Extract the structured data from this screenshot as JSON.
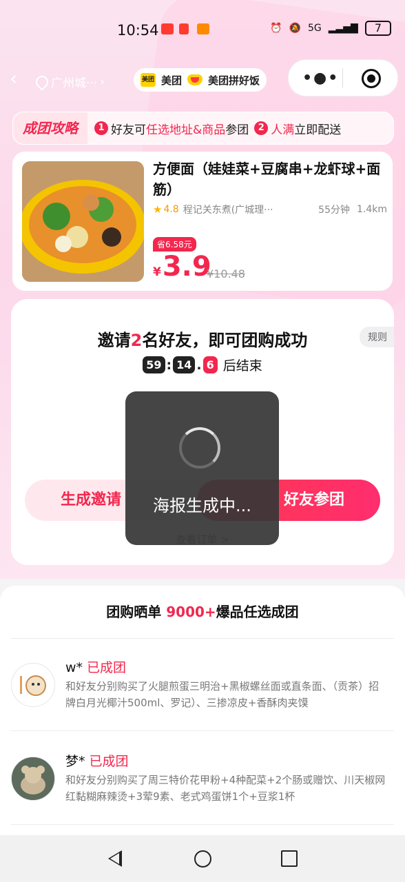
{
  "status_bar": {
    "time": "10:54",
    "network": "5G",
    "battery": "7"
  },
  "nav": {
    "location": "广州城···",
    "brand_meituan": "美团",
    "brand_pinhaofan": "美团拼好饭"
  },
  "strategy": {
    "tag": "成团攻略",
    "step1_num": "1",
    "step1_prefix": "好友可",
    "step1_highlight": "任选地址&商品",
    "step1_suffix": "参团",
    "step2_num": "2",
    "step2_highlight": "人满",
    "step2_suffix": "立即配送"
  },
  "product": {
    "name": "方便面（娃娃菜+豆腐串+龙虾球+面筋）",
    "rating": "4.8",
    "shop": "程记关东煮(广城理···",
    "time": "55分钟",
    "distance": "1.4km",
    "save_tag": "省6.58元",
    "currency": "¥",
    "price": "3.9",
    "original_price": "¥10.48"
  },
  "invite": {
    "rules": "规则",
    "title_prefix": "邀请",
    "title_count": "2",
    "title_suffix": "名好友，即可团购成功",
    "countdown_min": "59",
    "countdown_sec": "14",
    "countdown_tenth": "6",
    "countdown_suffix": "后结束",
    "poster_button": "生成邀请",
    "invite_button": "好友参团",
    "peek_text": "查看订单 >"
  },
  "toast": {
    "text": "海报生成中..."
  },
  "feed": {
    "title_prefix": "团购晒单",
    "title_count": "9000+",
    "title_suffix": "爆品任选成团",
    "entries": [
      {
        "name": "w*",
        "status": "已成团",
        "desc": "和好友分别购买了火腿煎蛋三明治+黑椒螺丝面或直条面、（贡茶）招牌白月光椰汁500ml、罗记）、三掺凉皮+香酥肉夹馍"
      },
      {
        "name": "梦*",
        "status": "已成团",
        "desc": "和好友分别购买了周三特价花甲粉+4种配菜+2个肠或赠饮、川天椒网红黏糊麻辣烫+3荤9素、老式鸡蛋饼1个+豆浆1杯"
      }
    ]
  }
}
